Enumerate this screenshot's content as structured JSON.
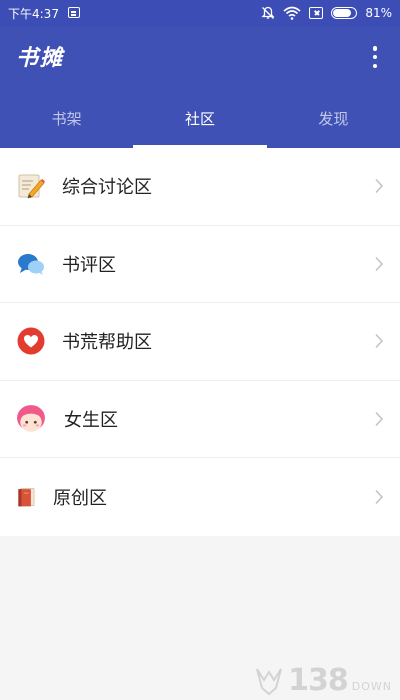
{
  "status_bar": {
    "time": "下午4:37",
    "battery": "81%",
    "battery_level": 0.81
  },
  "app_bar": {
    "title": "书摊"
  },
  "tabs": [
    {
      "label": "书架",
      "active": false
    },
    {
      "label": "社区",
      "active": true
    },
    {
      "label": "发现",
      "active": false
    }
  ],
  "community_list": [
    {
      "label": "综合讨论区",
      "icon": "notepad-pencil-icon"
    },
    {
      "label": "书评区",
      "icon": "chat-bubbles-icon"
    },
    {
      "label": "书荒帮助区",
      "icon": "heart-icon"
    },
    {
      "label": "女生区",
      "icon": "girl-face-icon"
    },
    {
      "label": "原创区",
      "icon": "book-icon"
    }
  ],
  "watermark": {
    "number": "138",
    "text": "DOWN"
  },
  "colors": {
    "primary": "#3f51b5",
    "status_bar": "#3d4db6",
    "background": "#f5f5f5"
  }
}
